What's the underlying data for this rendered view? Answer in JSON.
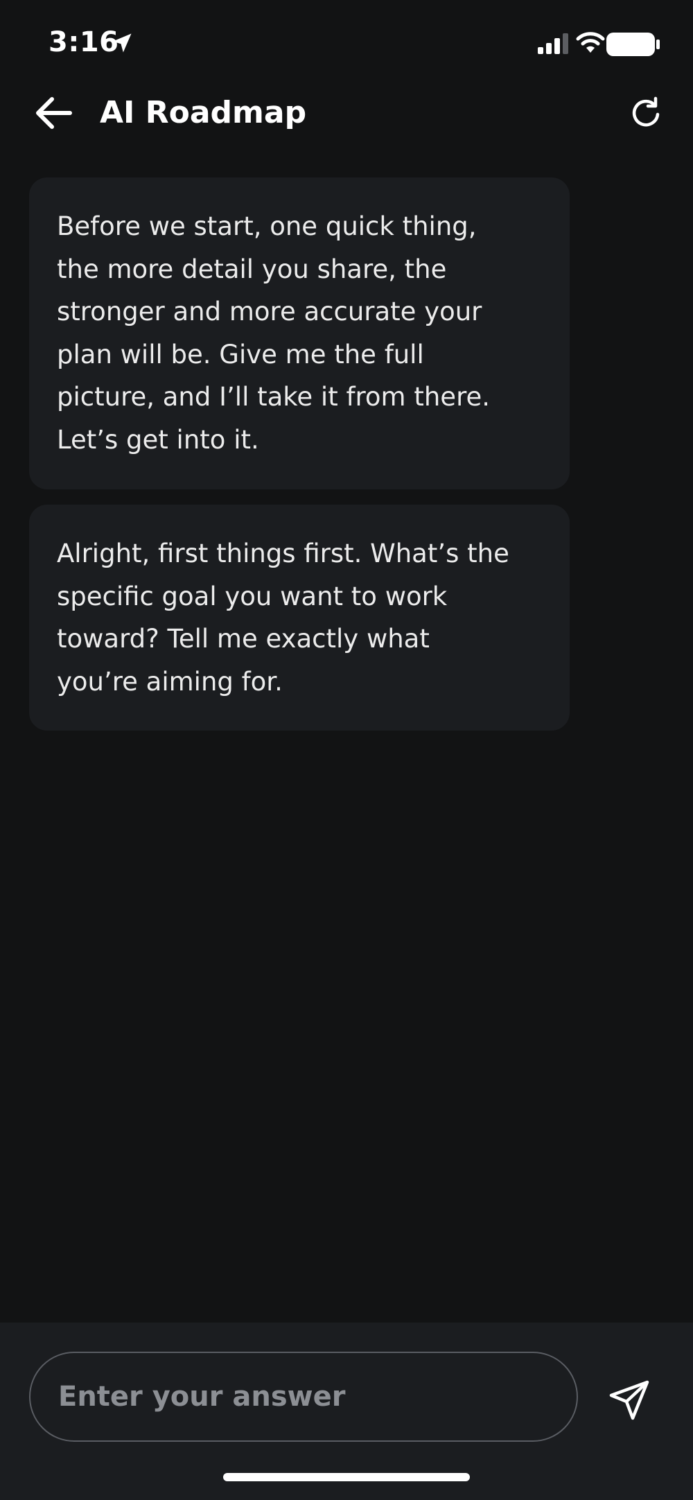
{
  "status_bar": {
    "time": "3:16",
    "icons": [
      "location-arrow-icon",
      "cellular-signal-icon",
      "wifi-icon",
      "battery-icon"
    ]
  },
  "header": {
    "title": "AI Roadmap",
    "back_icon": "arrow-left-icon",
    "refresh_icon": "refresh-icon"
  },
  "messages": [
    {
      "sender": "assistant",
      "text": "Before we start, one quick thing,\nthe more detail you share, the\nstronger and more accurate your\nplan will be. Give me the full\npicture, and I’ll take it from there.\nLet’s get into it."
    },
    {
      "sender": "assistant",
      "text": "Alright, first things first. What’s the\nspecific goal you want to work\ntoward? Tell me exactly what\nyou’re aiming for."
    }
  ],
  "composer": {
    "placeholder": "Enter your answer",
    "value": "",
    "send_icon": "send-icon"
  },
  "colors": {
    "background": "#121314",
    "bubble": "#1b1d20",
    "input_border": "#5a5d63",
    "placeholder": "#8c8f94",
    "text": "#ffffff"
  }
}
